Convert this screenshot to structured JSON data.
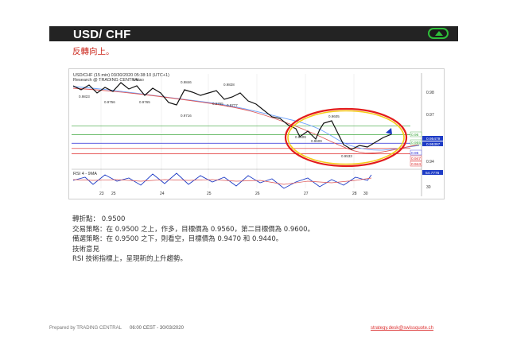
{
  "header": {
    "title": "USD/ CHF",
    "subtitle": "反轉向上。",
    "arrow_icon": "up-arrow-icon"
  },
  "chart": {
    "title_line1": "USD/CHF (15 min)   03/30/2020 05:38:10 (UTC+1)",
    "title_line2": "Research @ TRADING CENTRAL",
    "price_axis": [
      "0.98",
      "0.97",
      "0.96",
      "0.95",
      "0.94"
    ],
    "level_labels": [
      "0.96",
      "0.955",
      "0.95",
      "0.947",
      "0.944"
    ],
    "current_price": "0.95397",
    "current_price_prev": "0.95479",
    "swing_labels": [
      "0.9850",
      "0.9846",
      "0.9828",
      "0.9823",
      "0.9756",
      "0.9765",
      "0.9765",
      "0.9777",
      "0.9716",
      "0.9605",
      "0.9609",
      "0.9609",
      "0.9533"
    ],
    "rsi_label": "RSI 4 - 9MA",
    "rsi_value": "54.7776",
    "rsi_axis": [
      "30"
    ],
    "date_labels": [
      "23",
      "25",
      "24",
      "25",
      "26",
      "27",
      "28",
      "30"
    ]
  },
  "chart_data": {
    "type": "line",
    "x": [
      "23",
      "24",
      "25",
      "26",
      "27",
      "28",
      "30"
    ],
    "series": [
      {
        "values": [
          0.985,
          0.982,
          0.979,
          0.975,
          0.962,
          0.947,
          0.954
        ]
      }
    ],
    "ylim": [
      0.935,
      0.99
    ],
    "annotations": [
      {
        "value": 0.96,
        "label": "0.96",
        "color": "#3aa53a"
      },
      {
        "value": 0.955,
        "label": "0.955",
        "color": "#3aa53a"
      },
      {
        "value": 0.95,
        "label": "0.95",
        "color": "#2b2bd8"
      },
      {
        "value": 0.947,
        "label": "0.947",
        "color": "#d22"
      },
      {
        "value": 0.944,
        "label": "0.944",
        "color": "#d22"
      }
    ]
  },
  "analysis": {
    "pivot": "轉折點： 0.9500",
    "strategy": "交易策略：在 0.9500 之上，作多，目標價為 0.9560，第二目標價為 0.9600。",
    "alternative": "備選策略：在 0.9500 之下，則看空，目標價為 0.9470 和 0.9440。",
    "comment_title": "技術意見",
    "comment": "RSI 技術指標上，呈現新的上升趨勢。"
  },
  "footer": {
    "prepared_by": "Prepared by TRADING CENTRAL",
    "date": "06:00 CEST - 30/03/2020",
    "email": "strategy.desk@swissquote.ch"
  },
  "colors": {
    "accent_red": "#cc2a1f",
    "bar_dark": "#232323",
    "arrow_green": "#2fbf3a"
  }
}
